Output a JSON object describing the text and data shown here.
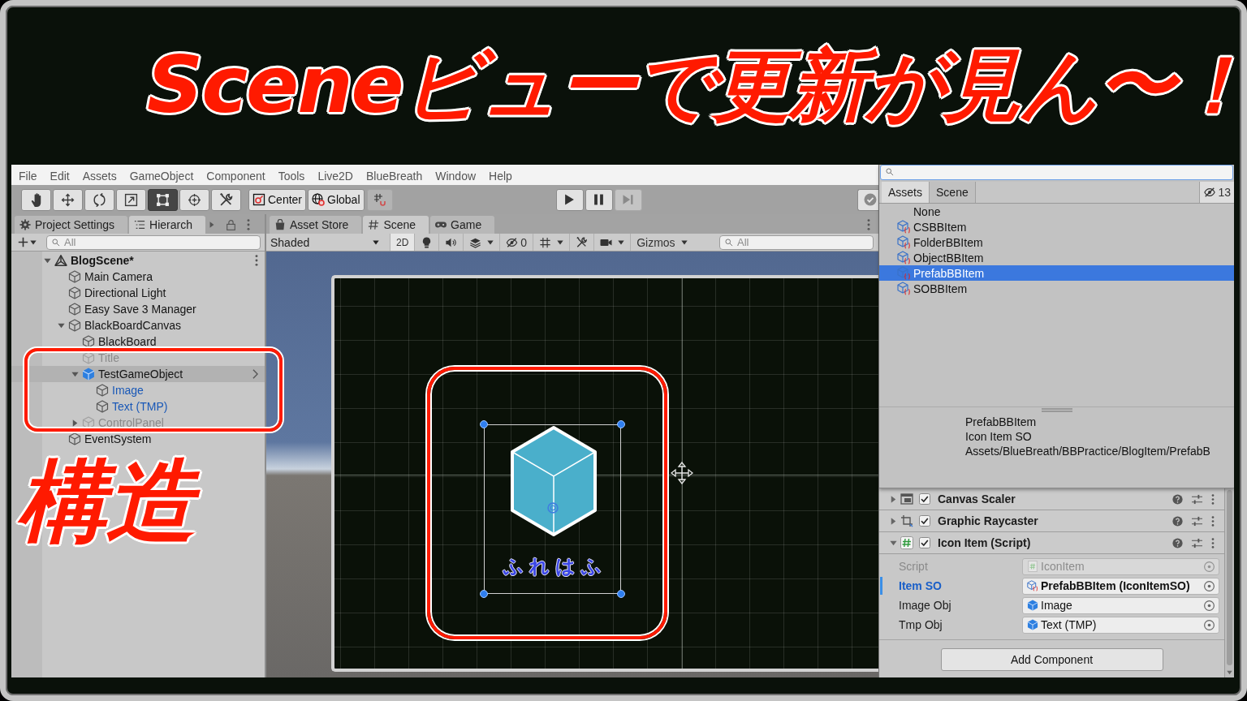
{
  "title": {
    "text": "Sceneビューで更新が見ん〜！"
  },
  "note": {
    "text": "構造"
  },
  "menu": [
    "File",
    "Edit",
    "Assets",
    "GameObject",
    "Component",
    "Tools",
    "Live2D",
    "BlueBreath",
    "Window",
    "Help"
  ],
  "toolbar": {
    "tools": [
      {
        "kind": "hand",
        "selected": false
      },
      {
        "kind": "move",
        "selected": false
      },
      {
        "kind": "rotate",
        "selected": false
      },
      {
        "kind": "scale",
        "selected": false
      },
      {
        "kind": "rect",
        "selected": true
      },
      {
        "kind": "transform",
        "selected": false
      },
      {
        "kind": "custom",
        "selected": false
      }
    ],
    "handle_buttons": [
      {
        "kind": "pivot",
        "label": "Center",
        "disabled": false
      },
      {
        "kind": "space",
        "label": "Global",
        "disabled": false
      },
      {
        "kind": "snap",
        "disabled": true
      }
    ],
    "playback": [
      {
        "kind": "play",
        "disabled": false
      },
      {
        "kind": "pause",
        "disabled": false
      },
      {
        "kind": "step",
        "disabled": true
      }
    ]
  },
  "hierarchy": {
    "tabs": [
      {
        "label": "Project Settings",
        "kind": "settings",
        "selected": false
      },
      {
        "label": "Hierarch",
        "kind": "hierarchy",
        "selected": true
      }
    ],
    "search": {
      "placeholder": "All"
    },
    "tree": [
      {
        "label": "BlogScene*",
        "kind": "scene",
        "expanded": true,
        "selected": false,
        "disabled": false,
        "children": [
          {
            "label": "Main Camera",
            "kind": "object",
            "selected": false,
            "disabled": false
          },
          {
            "label": "Directional Light",
            "kind": "object",
            "selected": false,
            "disabled": false
          },
          {
            "label": "Easy Save 3 Manager",
            "kind": "object",
            "selected": false,
            "disabled": false
          },
          {
            "label": "BlackBoardCanvas",
            "kind": "object",
            "expanded": true,
            "selected": false,
            "disabled": false,
            "children": [
              {
                "label": "BlackBoard",
                "kind": "object",
                "selected": false,
                "disabled": false
              },
              {
                "label": "Title",
                "kind": "object",
                "selected": false,
                "disabled": true
              },
              {
                "label": "TestGameObject",
                "kind": "prefab",
                "expanded": true,
                "selected": true,
                "disabled": false,
                "children": [
                  {
                    "label": "Image",
                    "kind": "prefab-child",
                    "selected": false,
                    "disabled": false
                  },
                  {
                    "label": "Text (TMP)",
                    "kind": "prefab-child",
                    "selected": false,
                    "disabled": false
                  }
                ]
              },
              {
                "label": "ControlPanel",
                "kind": "object",
                "expanded": false,
                "selected": false,
                "disabled": true
              }
            ]
          },
          {
            "label": "EventSystem",
            "kind": "object",
            "selected": false,
            "disabled": false
          }
        ]
      }
    ]
  },
  "scene": {
    "tabs": [
      {
        "label": "Asset Store",
        "kind": "store",
        "selected": false
      },
      {
        "label": "Scene",
        "kind": "scene",
        "selected": true
      },
      {
        "label": "Game",
        "kind": "game",
        "selected": false
      }
    ],
    "draw_mode": "Shaded",
    "buttons": [
      {
        "kind": "mode",
        "label": "2D",
        "dropdown": false
      },
      {
        "kind": "lighting",
        "dropdown": false
      },
      {
        "kind": "audio",
        "dropdown": false
      },
      {
        "kind": "effects",
        "dropdown": true
      },
      {
        "kind": "hidden",
        "label": "0",
        "dropdown": false
      },
      {
        "kind": "grid",
        "dropdown": true
      },
      {
        "kind": "tools",
        "dropdown": false
      },
      {
        "kind": "camera",
        "dropdown": true
      },
      {
        "kind": "gizmos",
        "label": "Gizmos",
        "dropdown": true
      }
    ],
    "search": {
      "placeholder": "All"
    },
    "object_text": "ふれはふ"
  },
  "picker": {
    "tabs": [
      {
        "label": "Assets",
        "selected": true
      },
      {
        "label": "Scene",
        "selected": false
      }
    ],
    "hidden_count": "13",
    "items": [
      {
        "label": "None",
        "kind": "none",
        "selected": false
      },
      {
        "label": "CSBBItem",
        "kind": "asset",
        "selected": false
      },
      {
        "label": "FolderBBItem",
        "kind": "asset",
        "selected": false
      },
      {
        "label": "ObjectBBItem",
        "kind": "asset",
        "selected": false
      },
      {
        "label": "PrefabBBItem",
        "kind": "asset",
        "selected": true
      },
      {
        "label": "SOBBItem",
        "kind": "asset",
        "selected": false
      }
    ],
    "preview": {
      "name": "PrefabBBItem",
      "type": "Icon Item SO",
      "path": "Assets/BlueBreath/BBPractice/BlogItem/PrefabB"
    }
  },
  "inspector": {
    "components": [
      {
        "label": "Canvas Scaler",
        "kind": "canvas-scaler",
        "enabled": true,
        "expanded": false
      },
      {
        "label": "Graphic Raycaster",
        "kind": "raycaster",
        "enabled": true,
        "expanded": false
      },
      {
        "label": "Icon Item (Script)",
        "kind": "script",
        "enabled": true,
        "expanded": true,
        "fields": [
          {
            "label": "Script",
            "value": "IconItem",
            "kind": "script",
            "disabled": true,
            "highlighted": false
          },
          {
            "label": "Item SO",
            "value": "PrefabBBItem (IconItemSO)",
            "kind": "asset",
            "disabled": false,
            "highlighted": true
          },
          {
            "label": "Image Obj",
            "value": "Image",
            "kind": "object",
            "disabled": false,
            "highlighted": false
          },
          {
            "label": "Tmp Obj",
            "value": "Text (TMP)",
            "kind": "object",
            "disabled": false,
            "highlighted": false
          }
        ]
      }
    ],
    "add_button": "Add Component"
  }
}
